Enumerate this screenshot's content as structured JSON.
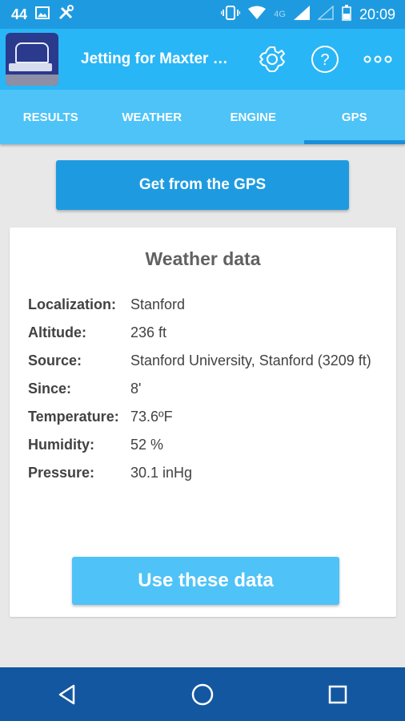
{
  "status_bar": {
    "notification_count": "44",
    "network_type": "4G",
    "time": "20:09"
  },
  "app_bar": {
    "title": "Jetting for Maxter K...",
    "icons": [
      "settings-icon",
      "help-icon",
      "overflow-menu-icon"
    ]
  },
  "tabs": [
    {
      "label": "RESULTS",
      "active": false
    },
    {
      "label": "WEATHER",
      "active": false
    },
    {
      "label": "ENGINE",
      "active": false
    },
    {
      "label": "GPS",
      "active": true
    }
  ],
  "gps_button": {
    "label": "Get from the GPS"
  },
  "weather_card": {
    "title": "Weather data",
    "rows": [
      {
        "label": "Localization:",
        "value": "Stanford"
      },
      {
        "label": "Altitude:",
        "value": "236 ft"
      },
      {
        "label": "Source:",
        "value": "Stanford University, Stanford (3209 ft)"
      },
      {
        "label": "Since:",
        "value": "8'"
      },
      {
        "label": "Temperature:",
        "value": "73.6ºF"
      },
      {
        "label": "Humidity:",
        "value": "52 %"
      },
      {
        "label": "Pressure:",
        "value": "30.1 inHg"
      }
    ],
    "use_button": "Use these data"
  },
  "colors": {
    "status_bar": "#1e9be0",
    "app_bar": "#29b6f6",
    "tabs": "#4dc3f7",
    "tab_indicator": "#1a8fdb",
    "primary_button": "#1e9be0",
    "secondary_button": "#4fc3f7",
    "nav_bar": "#1357a0"
  }
}
